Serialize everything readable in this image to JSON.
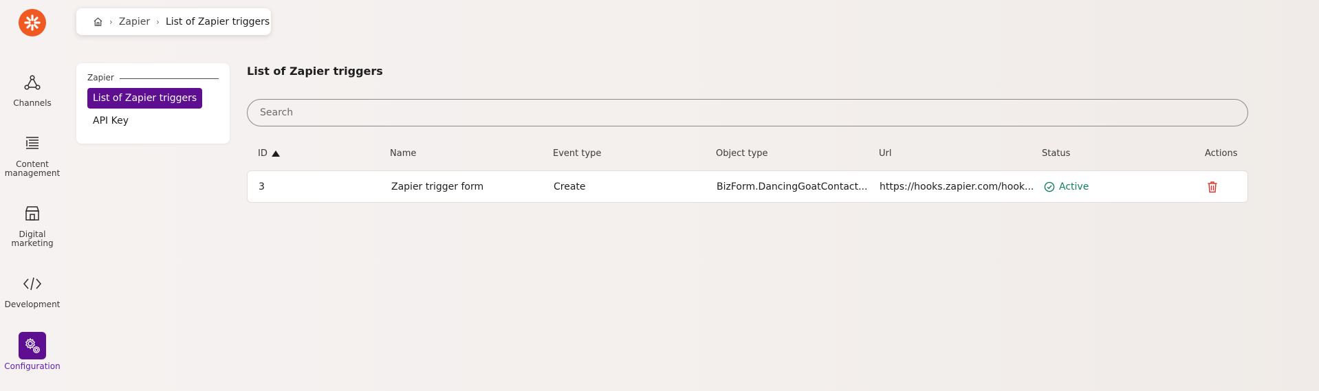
{
  "rail": {
    "items": [
      {
        "label": "Channels",
        "icon": "channels-icon"
      },
      {
        "label": "Content management",
        "icon": "content-management-icon"
      },
      {
        "label": "Digital marketing",
        "icon": "digital-marketing-icon"
      },
      {
        "label": "Development",
        "icon": "development-icon"
      },
      {
        "label": "Configuration",
        "icon": "configuration-icon",
        "active": true
      }
    ]
  },
  "breadcrumb": {
    "items": [
      "Zapier",
      "List of Zapier triggers"
    ]
  },
  "submenu": {
    "group_title": "Zapier",
    "items": [
      "List of Zapier triggers",
      "API Key"
    ]
  },
  "page": {
    "title": "List of Zapier triggers",
    "search_placeholder": "Search"
  },
  "table": {
    "columns": [
      "ID",
      "Name",
      "Event type",
      "Object type",
      "Url",
      "Status",
      "Actions"
    ],
    "sort": {
      "column": "ID",
      "direction": "ascending"
    },
    "rows": [
      {
        "id": "3",
        "name": "Zapier trigger form",
        "event_type": "Create",
        "object_type": "BizForm.DancingGoatContact...",
        "url": "https://hooks.zapier.com/hook...",
        "status": "Active"
      }
    ]
  },
  "colors": {
    "accent": "#5d0e91",
    "logo": "#f05a22",
    "status_active": "#12805c",
    "danger": "#d6312a"
  }
}
